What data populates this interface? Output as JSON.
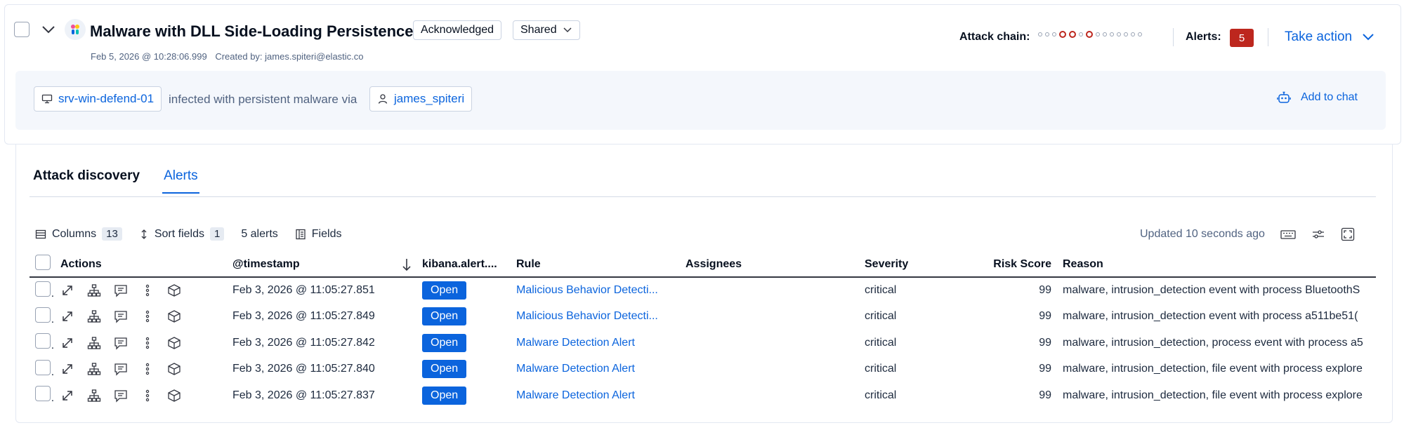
{
  "header": {
    "title": "Malware with DLL Side-Loading Persistence",
    "status_badge": "Acknowledged",
    "visibility_badge": "Shared",
    "timestamp": "Feb 5, 2026 @ 10:28:06.999",
    "created_by": "Created by: james.spiteri@elastic.co",
    "attack_chain_label": "Attack chain:",
    "attack_chain_stages": [
      false,
      false,
      false,
      true,
      true,
      false,
      true,
      false,
      false,
      false,
      false,
      false,
      false,
      false
    ],
    "alerts_label": "Alerts:",
    "alerts_count": "5",
    "take_action": "Take action"
  },
  "summary": {
    "host": "srv-win-defend-01",
    "text": "infected with persistent malware via",
    "user": "james_spiteri",
    "add_to_chat": "Add to chat"
  },
  "tabs": [
    {
      "label": "Attack discovery",
      "active": false
    },
    {
      "label": "Alerts",
      "active": true
    }
  ],
  "toolbar": {
    "columns_label": "Columns",
    "columns_count": "13",
    "sort_label": "Sort fields",
    "sort_count": "1",
    "alerts_total": "5 alerts",
    "fields_label": "Fields",
    "updated": "Updated 10 seconds ago"
  },
  "table": {
    "columns": [
      "Actions",
      "@timestamp",
      "kibana.alert....",
      "Rule",
      "Assignees",
      "Severity",
      "Risk Score",
      "Reason"
    ],
    "rows": [
      {
        "timestamp": "Feb 3, 2026 @ 11:05:27.851",
        "status": "Open",
        "rule": "Malicious Behavior Detecti...",
        "assignees": "",
        "severity": "critical",
        "risk": "99",
        "reason": "malware, intrusion_detection event with process BluetoothS"
      },
      {
        "timestamp": "Feb 3, 2026 @ 11:05:27.849",
        "status": "Open",
        "rule": "Malicious Behavior Detecti...",
        "assignees": "",
        "severity": "critical",
        "risk": "99",
        "reason": "malware, intrusion_detection event with process a511be51("
      },
      {
        "timestamp": "Feb 3, 2026 @ 11:05:27.842",
        "status": "Open",
        "rule": "Malware Detection Alert",
        "assignees": "",
        "severity": "critical",
        "risk": "99",
        "reason": "malware, intrusion_detection, process event with process a5"
      },
      {
        "timestamp": "Feb 3, 2026 @ 11:05:27.840",
        "status": "Open",
        "rule": "Malware Detection Alert",
        "assignees": "",
        "severity": "critical",
        "risk": "99",
        "reason": "malware, intrusion_detection, file event with process explore"
      },
      {
        "timestamp": "Feb 3, 2026 @ 11:05:27.837",
        "status": "Open",
        "rule": "Malware Detection Alert",
        "assignees": "",
        "severity": "critical",
        "risk": "99",
        "reason": "malware, intrusion_detection, file event with process explore"
      }
    ]
  },
  "colors": {
    "accent": "#0b64dd",
    "danger": "#bd271e"
  }
}
